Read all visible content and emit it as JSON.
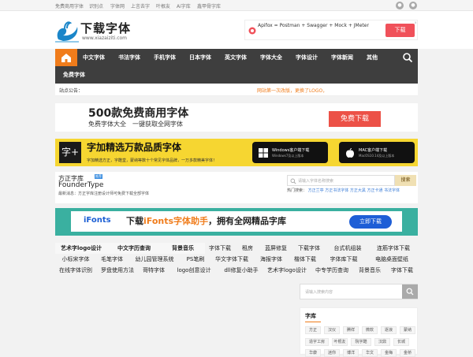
{
  "topbar": {
    "links": [
      "免费商用字体",
      "识别点",
      "字体网",
      "上言去字",
      "叶根友",
      "Ai字库",
      "鑫甲骨字库"
    ]
  },
  "logo": {
    "title": "下载字体",
    "url": "www.xiazaiziti.com"
  },
  "top_ad": {
    "text": "Apifox = Postman + Swagger + Mock + JMeter",
    "button": "下载",
    "close": "x"
  },
  "nav": {
    "items": [
      "中文字体",
      "书法字体",
      "手机字体",
      "日本字体",
      "英文字体",
      "字体大全",
      "字体设计",
      "字体新闻",
      "其他"
    ],
    "second_row": [
      "免费字体"
    ]
  },
  "notice": {
    "label": "站点公告：",
    "text": "网站第一次改版，更换了LOGO，"
  },
  "banner1": {
    "title": "500款免费商用字体",
    "subtitle": "免费字体大全　一键获取全网字体",
    "button": "免费下载"
  },
  "banner2": {
    "logo_char": "字+",
    "title": "字加精选万款品质字体",
    "subtitle": "字加精选方正，字酷堂，蒙纳等数十个常见字体品牌，一万多款精美字体！",
    "win_button": {
      "name": "Windows客户端下载",
      "version": "Windows7及以上版本"
    },
    "mac_button": {
      "name": "MAC客户端下载",
      "version": "MacOS10.14及以上版本"
    }
  },
  "founder": {
    "cn": "方正字库",
    "en": "FounderType",
    "badge": "推荐",
    "news": "最新消息：方正字库注册设计师可免费下载全部字体",
    "search_placeholder": "请输入字体名称搜索",
    "search_button": "搜索",
    "hot_label": "热门搜索：",
    "hot_items": [
      "方正兰亭",
      "方正书法字体",
      "方正大黑",
      "方正卡通",
      "书法字体"
    ]
  },
  "banner3": {
    "brand": "iFonts",
    "title_pre": "下载",
    "title_hl": "iFonts字体助手",
    "title_post": "，拥有全网精品字库",
    "button": "立即下载"
  },
  "links": {
    "rows": [
      [
        "艺术字logo设计",
        "中文字历查询",
        "背景音乐",
        "字体下载",
        "租房",
        "蓝屏修复",
        "下载字体",
        "台式机组装",
        "连筋字体下载"
      ],
      [
        "小标宋字体",
        "毛笔字体",
        "幼儿园管理系统",
        "PS笔刷",
        "华文字体下载",
        "海报字体",
        "楷体下载",
        "字体库下载",
        "电脑桌面壁纸"
      ],
      [
        "在线字体识别",
        "罗盘使用方法",
        "哥特字体",
        "logo创意设计",
        "dll修复小助手",
        "艺术字logo设计",
        "中专学历查询",
        "背景音乐",
        "字体下载"
      ]
    ]
  },
  "side_search": {
    "placeholder": "请输入搜索内容"
  },
  "tags": {
    "title": "字库",
    "items": [
      "方正",
      "汉仪",
      "腾祥",
      "微软",
      "逐浪",
      "蒙纳",
      "造字工房",
      "叶根友",
      "院字酷",
      "汉鼎",
      "长城",
      "华康",
      "迷你",
      "博洋",
      "华文",
      "金梅",
      "金桥"
    ]
  }
}
